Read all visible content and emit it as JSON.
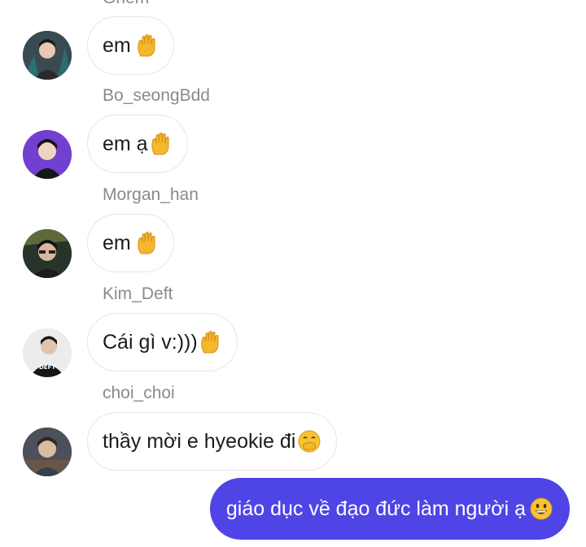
{
  "top_sender": "Ghem",
  "messages": [
    {
      "sender": "",
      "text": "em",
      "emoji": "raised-hand-icon",
      "avatar_color": "#2f3b45"
    },
    {
      "sender": "Bo_seongBdd",
      "text": "em ạ",
      "emoji": "raised-hand-icon",
      "avatar_color": "#6b34c9"
    },
    {
      "sender": "Morgan_han",
      "text": "em",
      "emoji": "raised-hand-icon",
      "avatar_color": "#2d3a2e"
    },
    {
      "sender": "Kim_Deft",
      "text": "Cái gì v:)))",
      "emoji": "raised-hand-icon",
      "avatar_color": "#1b1b1b"
    },
    {
      "sender": "choi_choi",
      "text": "thầy mời e hyeokie đi",
      "emoji": "face-with-hand-over-mouth-icon",
      "avatar_color": "#4a4f59"
    }
  ],
  "own_message": {
    "text": "giáo dục về đạo đức làm người ạ",
    "emoji": "smiling-face-icon",
    "color": "#4f44e6"
  },
  "avatar_badge_text": "DEFT"
}
